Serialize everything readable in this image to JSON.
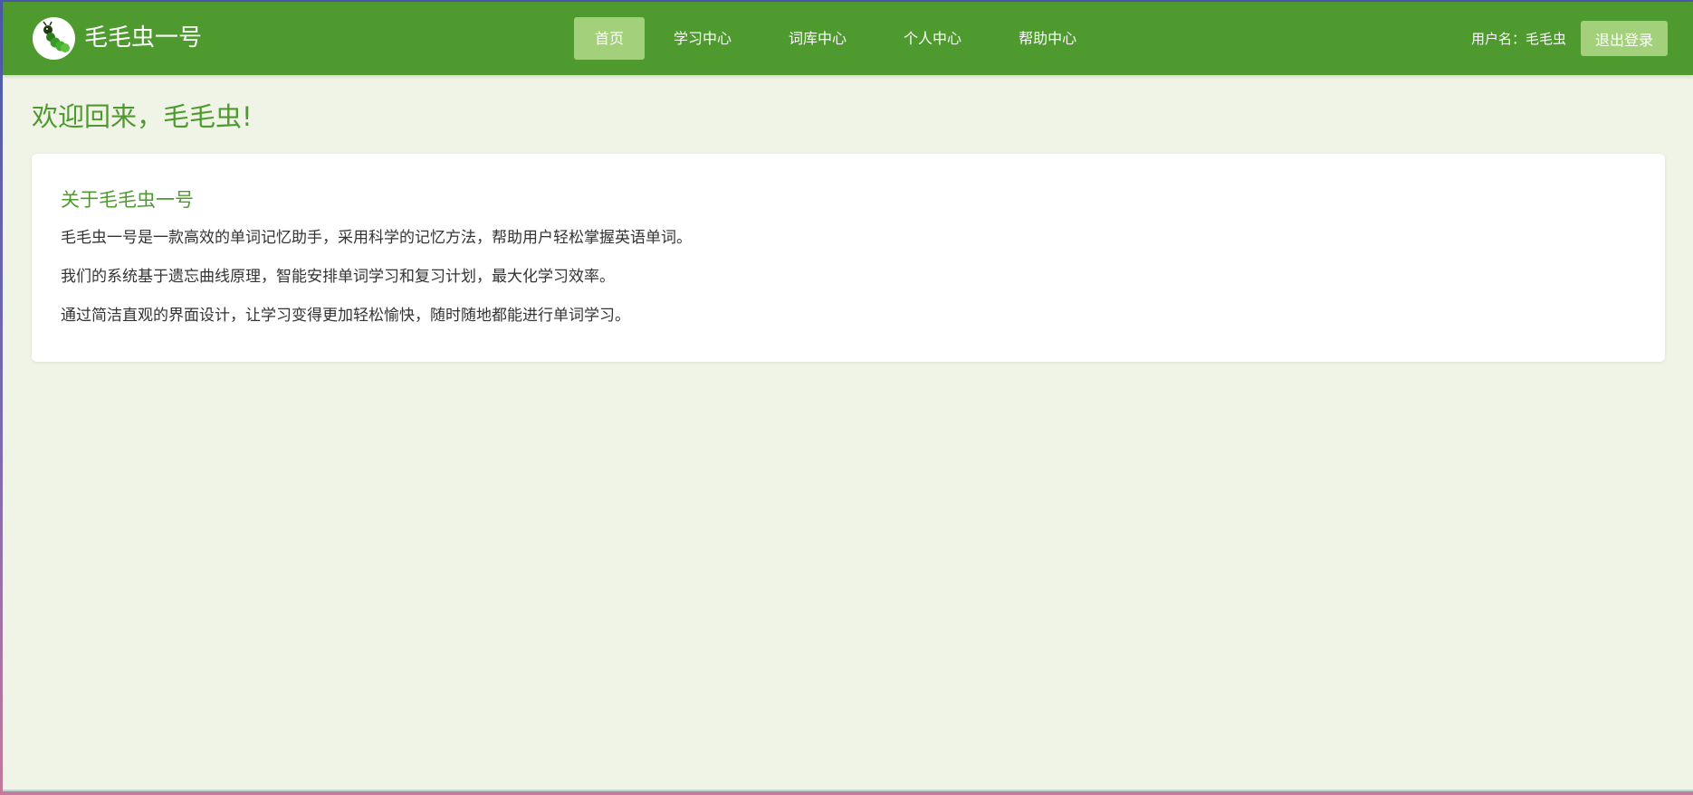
{
  "header": {
    "brand": "毛毛虫一号",
    "logo_icon": "caterpillar-icon",
    "nav": [
      {
        "label": "首页",
        "active": true
      },
      {
        "label": "学习中心",
        "active": false
      },
      {
        "label": "词库中心",
        "active": false
      },
      {
        "label": "个人中心",
        "active": false
      },
      {
        "label": "帮助中心",
        "active": false
      }
    ],
    "user_label": "用户名：毛毛虫",
    "logout_label": "退出登录"
  },
  "main": {
    "welcome": "欢迎回来，毛毛虫!",
    "about": {
      "title": "关于毛毛虫一号",
      "paragraphs": [
        "毛毛虫一号是一款高效的单词记忆助手，采用科学的记忆方法，帮助用户轻松掌握英语单词。",
        "我们的系统基于遗忘曲线原理，智能安排单词学习和复习计划，最大化学习效率。",
        "通过简洁直观的界面设计，让学习变得更加轻松愉快，随时随地都能进行单词学习。"
      ]
    }
  },
  "colors": {
    "primary": "#4e9a2f",
    "accent_light": "#a3d07a",
    "background": "#f0f4e6",
    "card": "#ffffff",
    "text": "#333333"
  }
}
